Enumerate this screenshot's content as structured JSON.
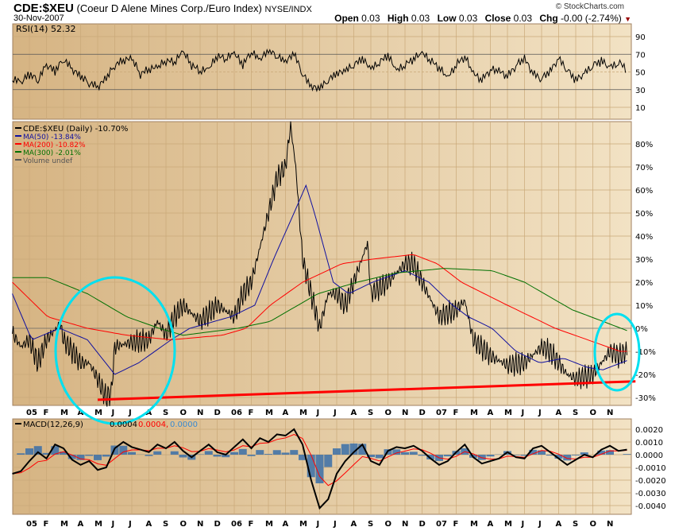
{
  "header": {
    "symbol": "CDE:$XEU",
    "name": "(Coeur D Alene Mines Corp./Euro Index)",
    "exchange": "NYSE/INDX",
    "date": "30-Nov-2007",
    "copyright": "© StockCharts.com",
    "open_label": "Open",
    "open": "0.03",
    "high_label": "High",
    "high": "0.03",
    "low_label": "Low",
    "low": "0.03",
    "close_label": "Close",
    "close": "0.03",
    "chg_label": "Chg",
    "chg": "-0.00 (-2.74%)"
  },
  "colors": {
    "panel": "#d8b888",
    "price": "#000000",
    "ma50": "#1010a0",
    "ma200": "#ff0000",
    "ma300": "#007000",
    "annotation_circle": "#00e0f0",
    "trendline": "#ff0000",
    "macd_hist": "#3a6ea8"
  },
  "chart_data": [
    {
      "type": "line",
      "title": "RSI(14) 52.32",
      "yticks": [
        "90",
        "70",
        "50",
        "30",
        "10"
      ],
      "ylim": [
        0,
        100
      ],
      "levels": [
        70,
        30
      ],
      "x_start_month": -1,
      "x_step_months": 0.5,
      "values": [
        40,
        35,
        45,
        38,
        55,
        48,
        62,
        50,
        42,
        35,
        30,
        40,
        55,
        60,
        62,
        45,
        50,
        52,
        60,
        58,
        70,
        55,
        48,
        50,
        65,
        62,
        68,
        55,
        70,
        60,
        72,
        65,
        58,
        68,
        45,
        30,
        28,
        38,
        45,
        48,
        55,
        62,
        50,
        58,
        66,
        48,
        55,
        62,
        68,
        60,
        52,
        40,
        55,
        65,
        45,
        38,
        50,
        48,
        42,
        55,
        62,
        45,
        40,
        48,
        62,
        50,
        38,
        45,
        55,
        60,
        52,
        58,
        52
      ]
    },
    {
      "type": "line",
      "title": "CDE:$XEU (Daily) -10.70%",
      "ylabel": "%",
      "ylim": [
        -33,
        92
      ],
      "yticks": [
        80,
        70,
        60,
        50,
        40,
        30,
        20,
        10,
        0,
        -10,
        -20,
        -30
      ],
      "legend": [
        "CDE:$XEU (Daily) -10.70%",
        "MA(50) -13.84%",
        "MA(200) -10.82%",
        "MA(300) -2.01%",
        "Volume undef"
      ],
      "series": [
        {
          "name": "CDE:$XEU",
          "points": [
            [
              -1,
              -2
            ],
            [
              -0.5,
              -8
            ],
            [
              0,
              -5
            ],
            [
              0.5,
              -15
            ],
            [
              1,
              -5
            ],
            [
              1.8,
              2
            ],
            [
              2,
              -5
            ],
            [
              3,
              -15
            ],
            [
              3.5,
              -15
            ],
            [
              4,
              -22
            ],
            [
              4.5,
              -30
            ],
            [
              4.8,
              -28
            ],
            [
              5,
              -8
            ],
            [
              6,
              -6
            ],
            [
              7,
              -5
            ],
            [
              7.5,
              3
            ],
            [
              8,
              -3
            ],
            [
              8.5,
              5
            ],
            [
              9,
              10
            ],
            [
              10,
              3
            ],
            [
              11,
              10
            ],
            [
              12,
              5
            ],
            [
              12.5,
              15
            ],
            [
              13,
              20
            ],
            [
              13.5,
              35
            ],
            [
              14,
              50
            ],
            [
              14.5,
              65
            ],
            [
              15,
              70
            ],
            [
              15.3,
              88
            ],
            [
              15.6,
              70
            ],
            [
              16,
              30
            ],
            [
              16.5,
              15
            ],
            [
              17,
              0
            ],
            [
              17.5,
              15
            ],
            [
              18,
              15
            ],
            [
              18.5,
              10
            ],
            [
              19,
              20
            ],
            [
              19.8,
              37
            ],
            [
              20,
              15
            ],
            [
              21,
              20
            ],
            [
              22,
              28
            ],
            [
              22.5,
              28
            ],
            [
              23,
              20
            ],
            [
              24,
              5
            ],
            [
              25,
              8
            ],
            [
              25.5,
              12
            ],
            [
              26,
              -5
            ],
            [
              27,
              -12
            ],
            [
              28,
              -16
            ],
            [
              29,
              -15
            ],
            [
              30,
              -8
            ],
            [
              30.5,
              -10
            ],
            [
              31,
              -15
            ],
            [
              31.5,
              -20
            ],
            [
              32,
              -22
            ],
            [
              33,
              -20
            ],
            [
              34,
              -10
            ],
            [
              34.5,
              -12
            ],
            [
              35,
              -10
            ]
          ]
        },
        {
          "name": "MA(50)",
          "points": [
            [
              -1,
              15
            ],
            [
              0.14,
              -5
            ],
            [
              1.77,
              0
            ],
            [
              3.4,
              -5
            ],
            [
              5,
              -20
            ],
            [
              6.4,
              -15
            ],
            [
              8.3,
              -5
            ],
            [
              9.4,
              0
            ],
            [
              11.8,
              5
            ],
            [
              13.2,
              10
            ],
            [
              14.3,
              30
            ],
            [
              15.5,
              50
            ],
            [
              16.2,
              62
            ],
            [
              16.7,
              50
            ],
            [
              17.8,
              20
            ],
            [
              18.7,
              15
            ],
            [
              20.1,
              20
            ],
            [
              22,
              25
            ],
            [
              23.4,
              20
            ],
            [
              24.8,
              10
            ],
            [
              25.7,
              5
            ],
            [
              27.1,
              0
            ],
            [
              28.5,
              -10
            ],
            [
              29.9,
              -15
            ],
            [
              31.3,
              -13
            ],
            [
              32.7,
              -17
            ],
            [
              33.6,
              -18
            ],
            [
              35,
              -14
            ]
          ]
        },
        {
          "name": "MA(200)",
          "points": [
            [
              -1,
              20
            ],
            [
              1.07,
              5
            ],
            [
              3.4,
              0
            ],
            [
              5.7,
              -3
            ],
            [
              8.3,
              -5
            ],
            [
              11.3,
              -3
            ],
            [
              12.7,
              0
            ],
            [
              14.1,
              10
            ],
            [
              16,
              20
            ],
            [
              18.3,
              28
            ],
            [
              20.1,
              30
            ],
            [
              22.5,
              32
            ],
            [
              23.9,
              28
            ],
            [
              25.3,
              20
            ],
            [
              28,
              10
            ],
            [
              30.8,
              0
            ],
            [
              32.7,
              -5
            ],
            [
              34.6,
              -10
            ],
            [
              35,
              -10
            ]
          ]
        },
        {
          "name": "MA(300)",
          "points": [
            [
              -1,
              22
            ],
            [
              1.07,
              22
            ],
            [
              3.4,
              15
            ],
            [
              5.7,
              5
            ],
            [
              7.6,
              0
            ],
            [
              9,
              -3
            ],
            [
              12.2,
              0
            ],
            [
              14.1,
              3
            ],
            [
              16.9,
              15
            ],
            [
              19.2,
              20
            ],
            [
              21.5,
              24
            ],
            [
              24.3,
              26
            ],
            [
              27.1,
              25
            ],
            [
              29,
              20
            ],
            [
              31.8,
              8
            ],
            [
              33.6,
              3
            ],
            [
              35,
              -1
            ]
          ]
        }
      ],
      "trendline": [
        [
          4,
          -31
        ],
        [
          35.5,
          -23
        ]
      ],
      "annotations": [
        "circle around May-Jun 2005 low",
        "circle around Nov 2007"
      ]
    },
    {
      "type": "line",
      "title": "MACD(12,26,9)",
      "macd": "0.0004",
      "signal": "0.0004",
      "histogram": "0.0000",
      "ylim": [
        -0.0045,
        0.0025
      ],
      "yticks": [
        "0.0020",
        "0.0010",
        "0.0000",
        "-0.0010",
        "-0.0020",
        "-0.0030",
        "-0.0040"
      ],
      "x_start_month": -1,
      "x_step_months": 0.5,
      "values": [
        -0.0015,
        -0.0013,
        -0.0005,
        0.0002,
        -0.0003,
        0.0008,
        0.0005,
        -0.0004,
        -0.0008,
        -0.0005,
        -0.0012,
        -0.001,
        0.0005,
        0.001,
        0.0006,
        0.0004,
        0.0002,
        0.0008,
        0.0005,
        0.001,
        0.0003,
        -0.0002,
        0.0003,
        0.0008,
        0.0002,
        0.0,
        0.0006,
        0.0012,
        0.0005,
        0.0013,
        0.001,
        0.0016,
        0.0015,
        0.002,
        0.0008,
        -0.002,
        -0.0042,
        -0.0035,
        -0.0015,
        -0.0005,
        0.0002,
        0.0008,
        -0.0005,
        -0.0008,
        0.0003,
        0.0006,
        0.0005,
        0.0007,
        0.0003,
        -0.0003,
        -0.0008,
        -0.0005,
        0.0002,
        0.0008,
        -0.0002,
        -0.0007,
        -0.0005,
        -0.0003,
        0.0002,
        -0.0002,
        -0.0003,
        0.0005,
        0.0007,
        0.0002,
        -0.0003,
        -0.0008,
        -0.0004,
        0.0,
        -0.0002,
        0.0004,
        0.0007,
        0.0003,
        0.0004
      ]
    }
  ],
  "xaxis": {
    "labels": [
      "05",
      "F",
      "M",
      "A",
      "M",
      "J",
      "J",
      "A",
      "S",
      "O",
      "N",
      "D",
      "06",
      "F",
      "M",
      "A",
      "M",
      "J",
      "J",
      "A",
      "S",
      "O",
      "N",
      "D",
      "07",
      "F",
      "M",
      "A",
      "M",
      "J",
      "J",
      "A",
      "S",
      "O",
      "N"
    ]
  }
}
